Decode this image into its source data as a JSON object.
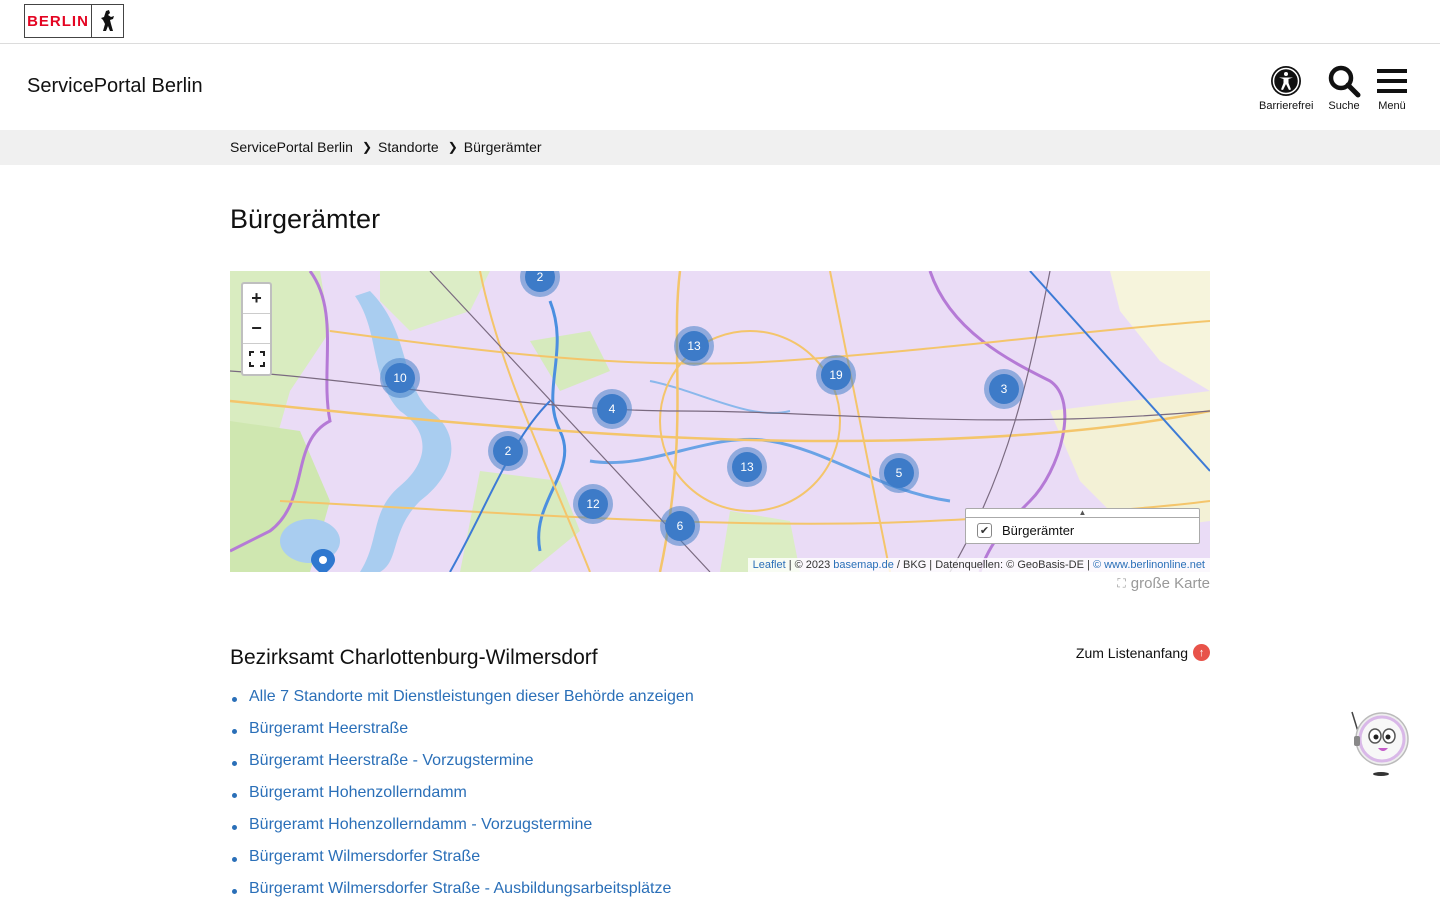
{
  "logo": {
    "text": "BERLIN",
    "icon": "bear-icon"
  },
  "header": {
    "site_name": "ServicePortal Berlin",
    "buttons": [
      {
        "label": "Barrierefrei",
        "icon": "accessibility-icon"
      },
      {
        "label": "Suche",
        "icon": "search-icon"
      },
      {
        "label": "Menü",
        "icon": "hamburger-menu-icon"
      }
    ]
  },
  "breadcrumb": [
    "ServicePortal Berlin",
    "Standorte",
    "Bürgerämter"
  ],
  "page_title": "Bürgerämter",
  "map": {
    "zoom_in": "+",
    "zoom_out": "−",
    "clusters": [
      "2",
      "13",
      "10",
      "19",
      "3",
      "4",
      "2",
      "13",
      "5",
      "12",
      "6"
    ],
    "layer_label": "Bürgerämter",
    "layer_checked": true,
    "attribution": {
      "leaflet": "Leaflet",
      "copyright": "| © 2023",
      "basemap": "basemap.de",
      "sources": "/ BKG | Datenquellen: © GeoBasis-DE |",
      "berlinonline": "© www.berlinonline.net"
    },
    "big_map_label": "große Karte"
  },
  "section": {
    "title": "Bezirksamt Charlottenburg-Wilmersdorf",
    "back_to_top": "Zum Listenanfang",
    "items": [
      "Alle 7 Standorte mit Dienstleistungen dieser Behörde anzeigen",
      "Bürgeramt Heerstraße",
      "Bürgeramt Heerstraße - Vorzugstermine",
      "Bürgeramt Hohenzollerndamm",
      "Bürgeramt Hohenzollerndamm - Vorzugstermine",
      "Bürgeramt Wilmersdorfer Straße",
      "Bürgeramt Wilmersdorfer Straße - Ausbildungsarbeitsplätze"
    ]
  },
  "colors": {
    "link": "#2a6fb8",
    "brand": "#e40422",
    "cluster": "#3d7bc8"
  }
}
